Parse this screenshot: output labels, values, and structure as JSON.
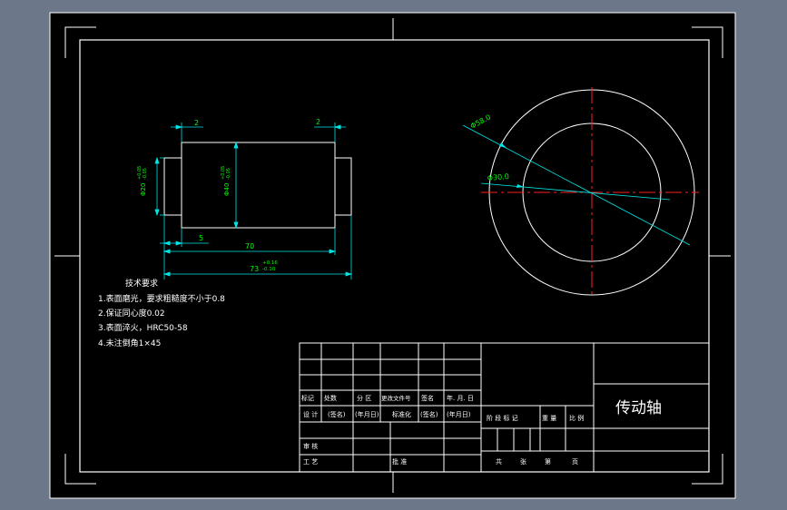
{
  "drawing": {
    "colors": {
      "background": "#6c7889",
      "sheet": "#000000",
      "frame": "#ffffff",
      "dimension": "#00e6e6",
      "dim_text": "#00ff00",
      "centerline": "#ff2020"
    },
    "dimensions": {
      "left_step": "2",
      "right_step": "2",
      "shoulder": "5",
      "body_length": "70",
      "overall_length": "73",
      "overall_tol_upper": "+0.16",
      "overall_tol_lower": "-0.10",
      "end_dia": "Φ20",
      "end_dia_tol_upper": "+0.05",
      "end_dia_tol_lower": "-0.05",
      "body_dia": "Φ40",
      "body_dia_tol_upper": "+0.05",
      "body_dia_tol_lower": "-0.05",
      "outer_circle": "Φ58.0",
      "inner_circle": "Φ30.0"
    },
    "notes": {
      "title": "技术要求",
      "items": [
        "1.表面磨光，要求粗糙度不小于0.8",
        "2.保证同心度0.02",
        "3.表面淬火，HRC50-58",
        "4.未注倒角1×45"
      ]
    },
    "title_block": {
      "part_name": "传动轴",
      "row_marks": [
        "标记",
        "处数",
        "分 区",
        "更改文件号",
        "签名",
        "年. 月. 日"
      ],
      "row_design": [
        "设 计",
        "(签名)",
        "(年月日)",
        "标准化",
        "(签名)",
        "(年月日)"
      ],
      "stage_headers": [
        "阶 段 标 记",
        "重 量",
        "比 例"
      ],
      "audit": "审 核",
      "process": "工 艺",
      "approve": "批 准",
      "sheets": [
        "共",
        "张",
        "第",
        "页"
      ]
    }
  }
}
